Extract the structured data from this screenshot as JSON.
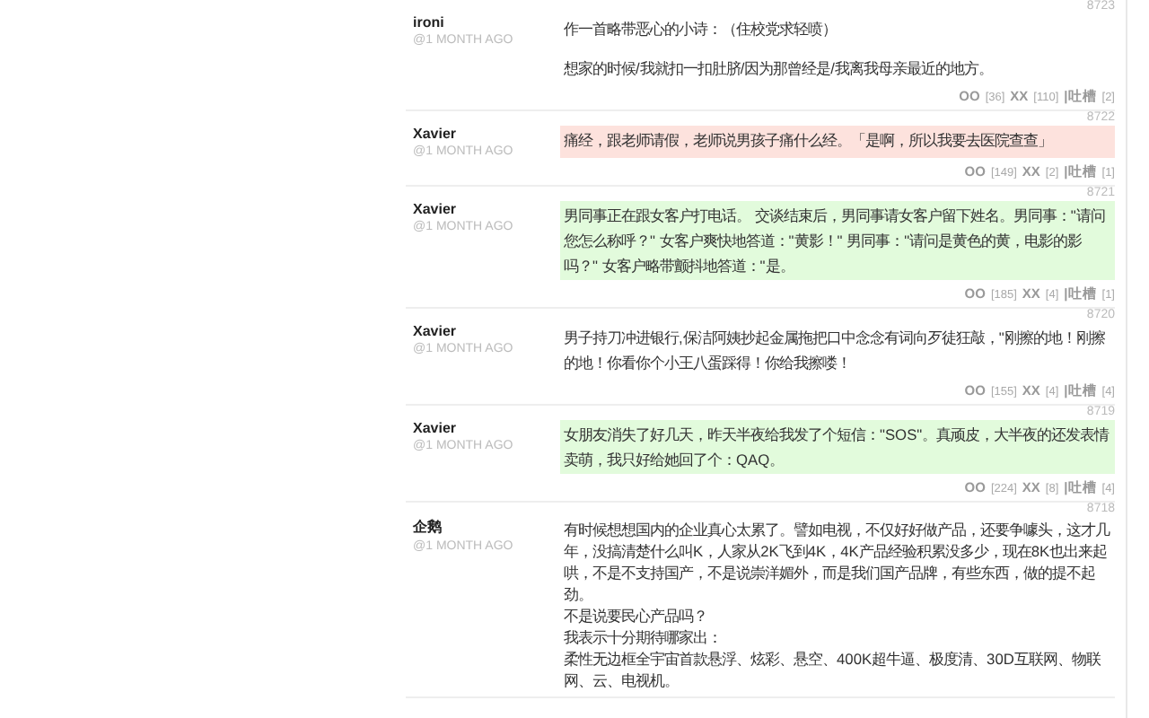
{
  "comments": [
    {
      "number": "8723",
      "author": "ironi",
      "time": "@1 MONTH AGO",
      "paragraphs": [
        "作一首略带恶心的小诗：（住校党求轻喷）",
        "想家的时候/我就扣一扣肚脐/因为那曾经是/我离我母亲最近的地方。"
      ],
      "votes": [
        {
          "label": "OO",
          "count": "[36]"
        },
        {
          "label": "XX",
          "count": "[110]"
        },
        {
          "label": "|吐槽",
          "count": "[2]"
        }
      ]
    },
    {
      "number": "8722",
      "author": "Xavier",
      "time": "@1 MONTH AGO",
      "color": "#fde2dd",
      "paragraphs": [
        "痛经，跟老师请假，老师说男孩子痛什么经。「是啊，所以我要去医院查查」"
      ],
      "votes": [
        {
          "label": "OO",
          "count": "[149]"
        },
        {
          "label": "XX",
          "count": "[2]"
        },
        {
          "label": "|吐槽",
          "count": "[1]"
        }
      ]
    },
    {
      "number": "8721",
      "author": "Xavier",
      "time": "@1 MONTH AGO",
      "color": "#e2fbdc",
      "paragraphs": [
        "男同事正在跟女客户打电话。 交谈结束后，男同事请女客户留下姓名。男同事：\"请问您怎么称呼？\" 女客户爽快地答道：\"黄影！\" 男同事：\"请问是黄色的黄，电影的影吗？\" 女客户略带颤抖地答道：\"是。"
      ],
      "votes": [
        {
          "label": "OO",
          "count": "[185]"
        },
        {
          "label": "XX",
          "count": "[4]"
        },
        {
          "label": "|吐槽",
          "count": "[1]"
        }
      ]
    },
    {
      "number": "8720",
      "author": "Xavier",
      "time": "@1 MONTH AGO",
      "paragraphs": [
        "男子持刀冲进银行,保洁阿姨抄起金属拖把口中念念有词向歹徒狂敲，\"刚擦的地！刚擦的地！你看你个小王八蛋踩得！你给我擦喽！"
      ],
      "votes": [
        {
          "label": "OO",
          "count": "[155]"
        },
        {
          "label": "XX",
          "count": "[4]"
        },
        {
          "label": "|吐槽",
          "count": "[4]"
        }
      ]
    },
    {
      "number": "8719",
      "author": "Xavier",
      "time": "@1 MONTH AGO",
      "color": "#e2fbdc",
      "paragraphs": [
        "女朋友消失了好几天，昨天半夜给我发了个短信：\"SOS\"。真顽皮，大半夜的还发表情卖萌，我只好给她回了个：QAQ。"
      ],
      "votes": [
        {
          "label": "OO",
          "count": "[224]"
        },
        {
          "label": "XX",
          "count": "[8]"
        },
        {
          "label": "|吐槽",
          "count": "[4]"
        }
      ]
    },
    {
      "number": "8718",
      "author": "企鹅",
      "time": "@1 MONTH AGO",
      "lines": [
        "有时候想想国内的企业真心太累了。譬如电视，不仅好好做产品，还要争噱头，这才几年，没搞清楚什么叫K，人家从2K飞到4K，4K产品经验积累没多少，现在8K也出来起哄，不是不支持国产，不是说崇洋媚外，而是我们国产品牌，有些东西，做的提不起劲。",
        "不是说要民心产品吗？",
        "我表示十分期待哪家出：",
        "柔性无边框全宇宙首款悬浮、炫彩、悬空、400K超牛逼、极度清、30D互联网、物联网、云、电视机。"
      ]
    }
  ]
}
